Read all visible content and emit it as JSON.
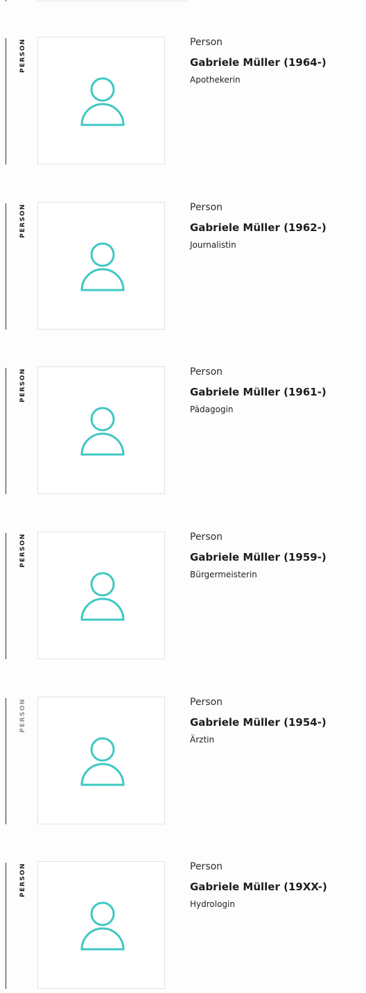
{
  "accent_color": "#3ec8c2",
  "results": [
    {
      "type_label": "PERSON",
      "kind": "Person",
      "name": "Gabriele Müller (1964-)",
      "role": "Apothekerin",
      "icon": "person-placeholder-icon"
    },
    {
      "type_label": "PERSON",
      "kind": "Person",
      "name": "Gabriele Müller (1962-)",
      "role": "Journalistin",
      "icon": "person-placeholder-icon"
    },
    {
      "type_label": "PERSON",
      "kind": "Person",
      "name": "Gabriele Müller (1961-)",
      "role": "Pädagogin",
      "icon": "person-placeholder-icon"
    },
    {
      "type_label": "PERSON",
      "kind": "Person",
      "name": "Gabriele Müller (1959-)",
      "role": "Bürgermeisterin",
      "icon": "person-placeholder-icon"
    },
    {
      "type_label": "PERSON",
      "kind": "Person",
      "name": "Gabriele Müller (1954-)",
      "role": "Ärztin",
      "icon": "person-placeholder-icon"
    },
    {
      "type_label": "PERSON",
      "kind": "Person",
      "name": "Gabriele Müller (19XX-)",
      "role": "Hydrologin",
      "icon": "person-placeholder-icon"
    }
  ]
}
